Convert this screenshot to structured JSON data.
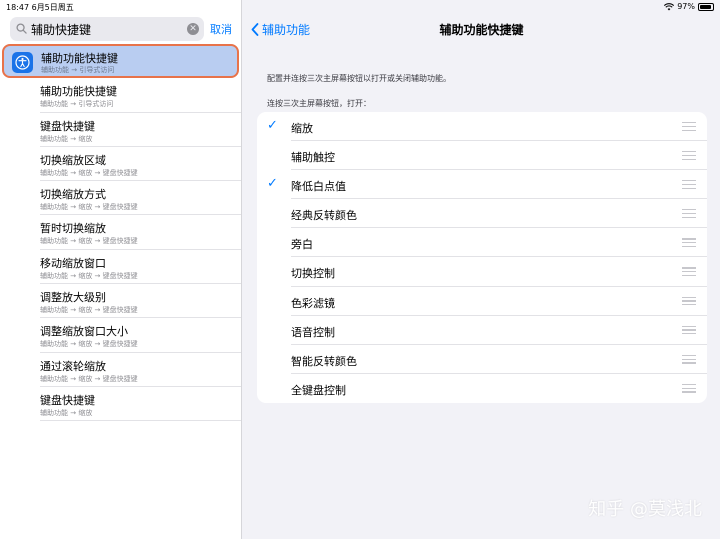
{
  "status": {
    "time_date": "18:47  6月5日周五",
    "battery": "97%"
  },
  "search": {
    "value": "辅助快捷键",
    "cancel": "取消"
  },
  "results": [
    {
      "title": "辅助功能快捷键",
      "sub": "辅助功能 → 引导式访问",
      "selected": true
    },
    {
      "title": "辅助功能快捷键",
      "sub": "辅助功能 → 引导式访问"
    },
    {
      "title": "键盘快捷键",
      "sub": "辅助功能 → 缩放"
    },
    {
      "title": "切换缩放区域",
      "sub": "辅助功能 → 缩放 → 键盘快捷键"
    },
    {
      "title": "切换缩放方式",
      "sub": "辅助功能 → 缩放 → 键盘快捷键"
    },
    {
      "title": "暂时切换缩放",
      "sub": "辅助功能 → 缩放 → 键盘快捷键"
    },
    {
      "title": "移动缩放窗口",
      "sub": "辅助功能 → 缩放 → 键盘快捷键"
    },
    {
      "title": "调整放大级别",
      "sub": "辅助功能 → 缩放 → 键盘快捷键"
    },
    {
      "title": "调整缩放窗口大小",
      "sub": "辅助功能 → 缩放 → 键盘快捷键"
    },
    {
      "title": "通过滚轮缩放",
      "sub": "辅助功能 → 缩放 → 键盘快捷键"
    },
    {
      "title": "键盘快捷键",
      "sub": "辅助功能 → 缩放"
    }
  ],
  "detail": {
    "back": "辅助功能",
    "title": "辅助功能快捷键",
    "description": "配置并连按三次主屏幕按钮以打开或关闭辅助功能。",
    "section_label": "连按三次主屏幕按钮，打开：",
    "options": [
      {
        "label": "缩放",
        "checked": true
      },
      {
        "label": "辅助触控",
        "checked": false
      },
      {
        "label": "降低白点值",
        "checked": true
      },
      {
        "label": "经典反转颜色",
        "checked": false
      },
      {
        "label": "旁白",
        "checked": false
      },
      {
        "label": "切换控制",
        "checked": false
      },
      {
        "label": "色彩滤镜",
        "checked": false
      },
      {
        "label": "语音控制",
        "checked": false
      },
      {
        "label": "智能反转颜色",
        "checked": false
      },
      {
        "label": "全键盘控制",
        "checked": false
      }
    ]
  },
  "watermark": "知乎 @莫浅北",
  "colors": {
    "accent": "#007aff",
    "selected_bg": "#b9cdf1",
    "highlight_border": "#e8734a"
  },
  "icons": {
    "check": "checkmark-icon",
    "reorder": "reorder-handle-icon",
    "back": "chevron-left-icon",
    "search": "search-icon",
    "clear": "clear-icon",
    "app": "accessibility-icon"
  }
}
